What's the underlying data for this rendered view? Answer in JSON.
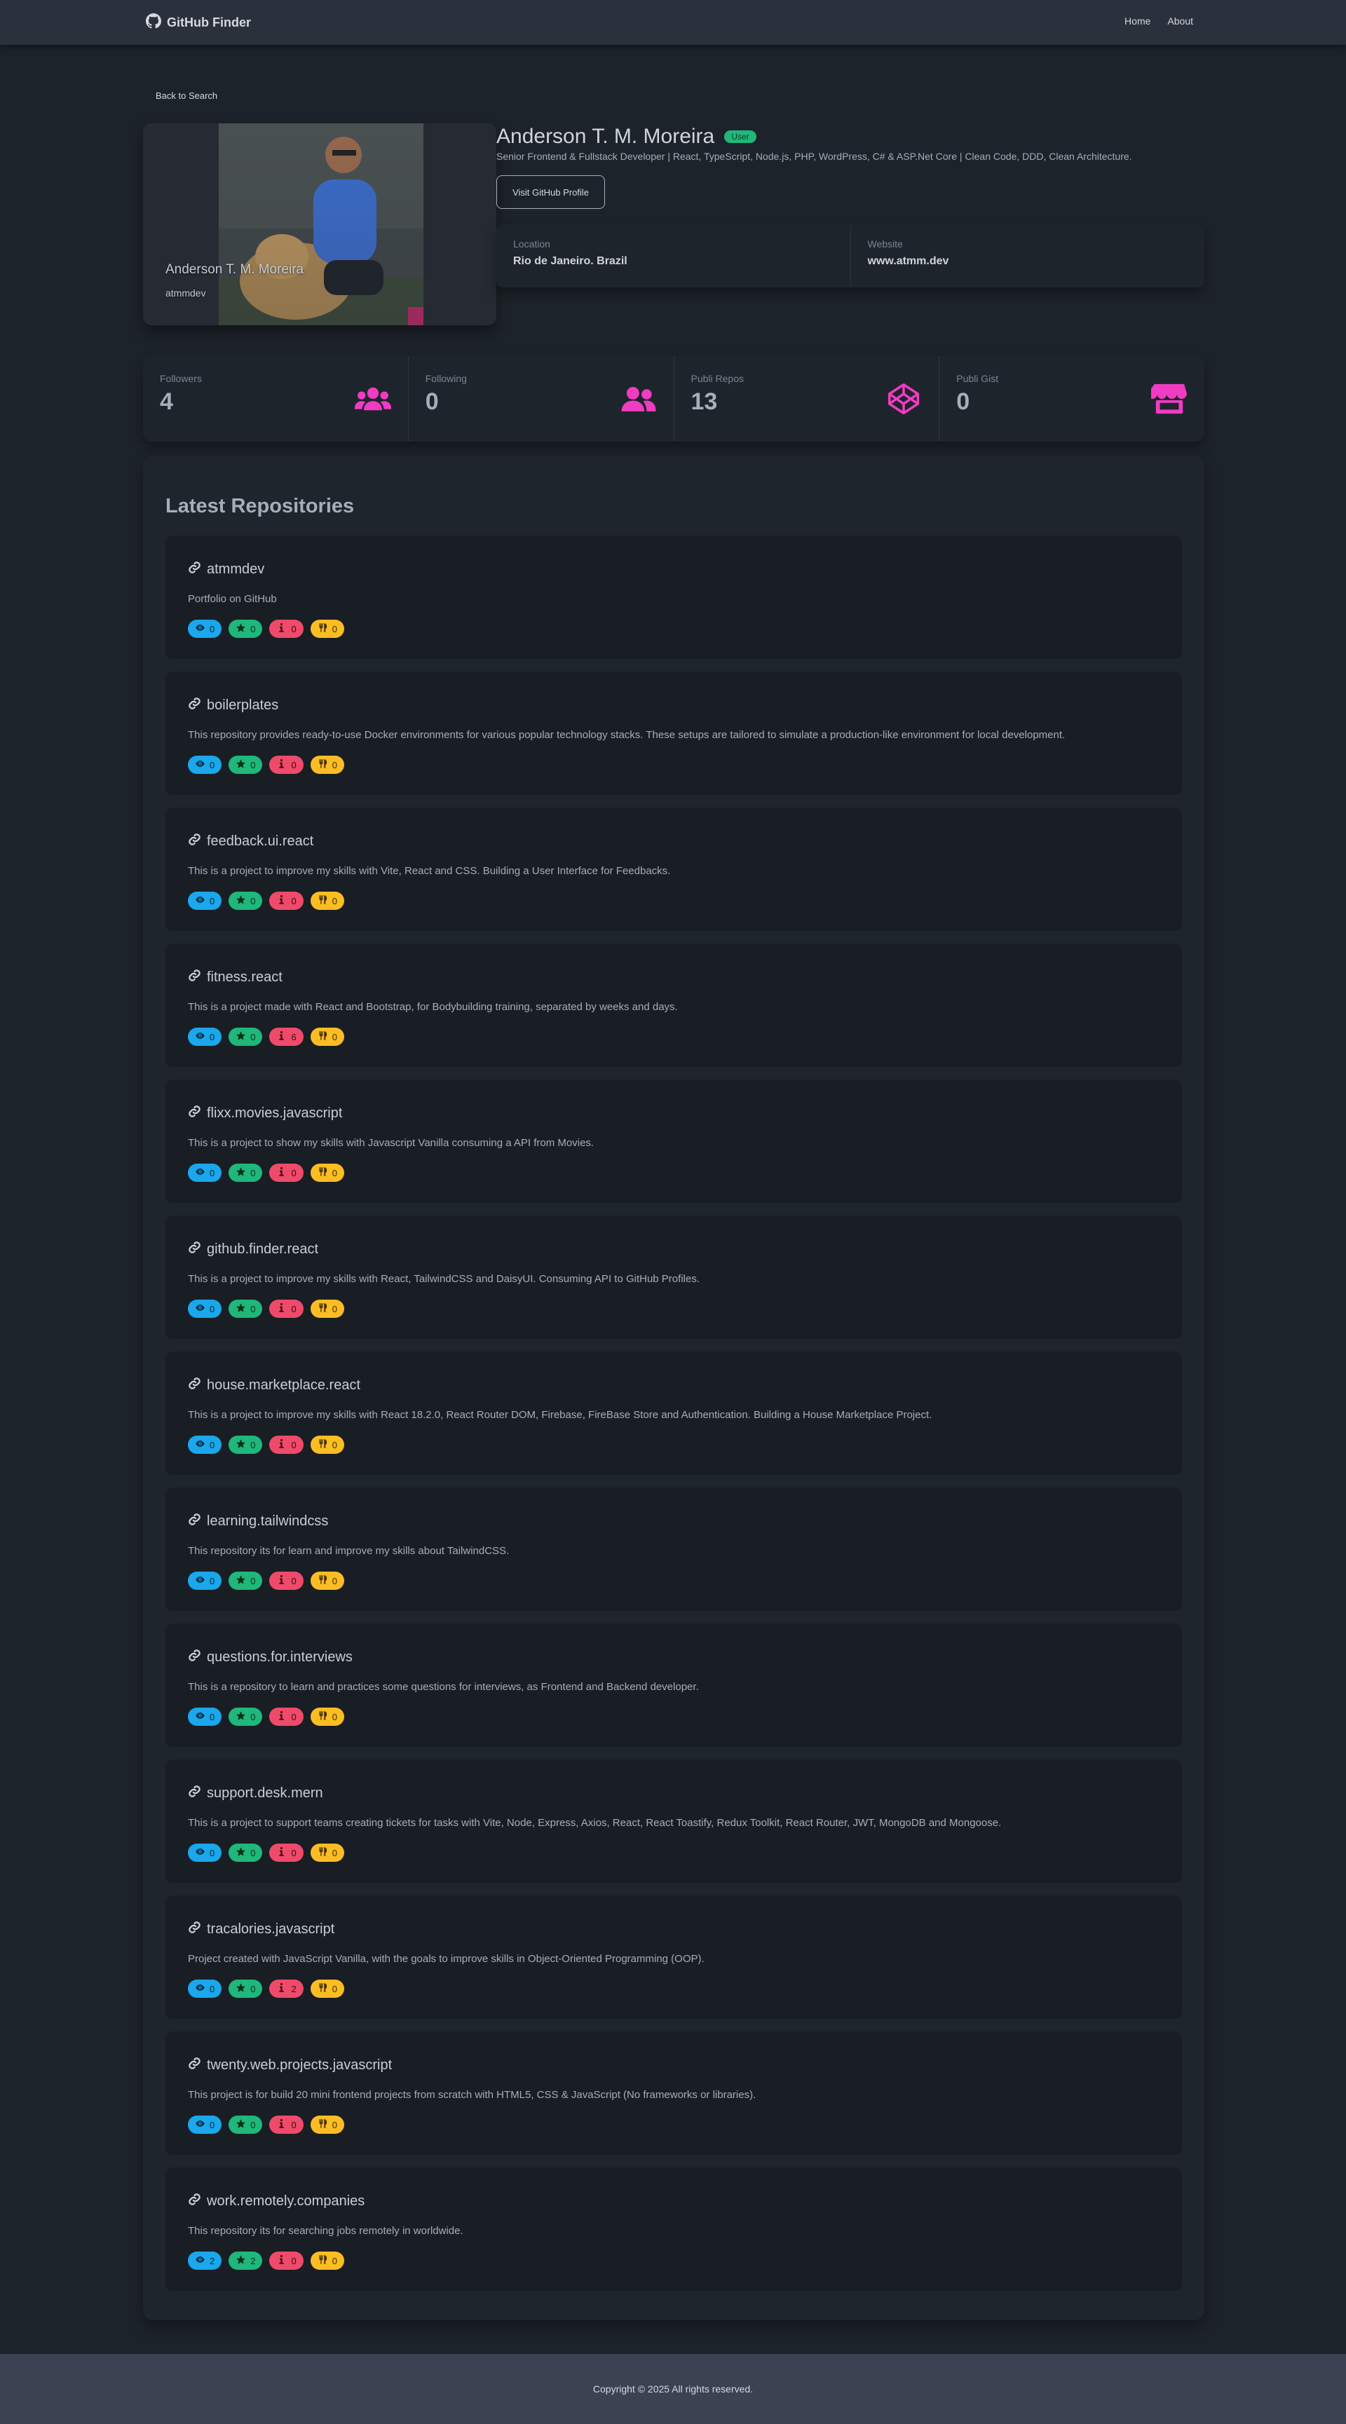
{
  "navbar": {
    "brand": "GitHub Finder",
    "links": [
      "Home",
      "About"
    ]
  },
  "back_label": "Back to Search",
  "profile": {
    "name": "Anderson T. M. Moreira",
    "login": "atmmdev",
    "type_badge": "User",
    "bio": "Senior Frontend & Fullstack Developer | React, TypeScript, Node.js, PHP, WordPress, C# & ASP.Net Core | Clean Code, DDD, Clean Architecture.",
    "visit_label": "Visit GitHub Profile",
    "location_label": "Location",
    "location": "Rio de Janeiro. Brazil",
    "website_label": "Website",
    "website": "www.atmm.dev"
  },
  "stats": [
    {
      "title": "Followers",
      "value": "4",
      "icon": "users-icon"
    },
    {
      "title": "Following",
      "value": "0",
      "icon": "user-friends-icon"
    },
    {
      "title": "Publi Repos",
      "value": "13",
      "icon": "codepen-icon"
    },
    {
      "title": "Publi Gist",
      "value": "0",
      "icon": "store-icon"
    }
  ],
  "repos_title": "Latest Repositories",
  "repos": [
    {
      "name": "atmmdev",
      "description": "Portfolio on GitHub",
      "watchers": "0",
      "stars": "0",
      "issues": "0",
      "forks": "0"
    },
    {
      "name": "boilerplates",
      "description": "This repository provides ready-to-use Docker environments for various popular technology stacks. These setups are tailored to simulate a production-like environment for local development.",
      "watchers": "0",
      "stars": "0",
      "issues": "0",
      "forks": "0"
    },
    {
      "name": "feedback.ui.react",
      "description": "This is a project to improve my skills with Vite, React and CSS. Building a User Interface for Feedbacks.",
      "watchers": "0",
      "stars": "0",
      "issues": "0",
      "forks": "0"
    },
    {
      "name": "fitness.react",
      "description": "This is a project made with React and Bootstrap, for Bodybuilding training, separated by weeks and days.",
      "watchers": "0",
      "stars": "0",
      "issues": "6",
      "forks": "0"
    },
    {
      "name": "flixx.movies.javascript",
      "description": "This is a project to show my skills with Javascript Vanilla consuming a API from Movies.",
      "watchers": "0",
      "stars": "0",
      "issues": "0",
      "forks": "0"
    },
    {
      "name": "github.finder.react",
      "description": "This is a project to improve my skills with React, TailwindCSS and DaisyUI. Consuming API to GitHub Profiles.",
      "watchers": "0",
      "stars": "0",
      "issues": "0",
      "forks": "0"
    },
    {
      "name": "house.marketplace.react",
      "description": "This is a project to improve my skills with React 18.2.0, React Router DOM, Firebase, FireBase Store and Authentication. Building a House Marketplace Project.",
      "watchers": "0",
      "stars": "0",
      "issues": "0",
      "forks": "0"
    },
    {
      "name": "learning.tailwindcss",
      "description": "This repository its for learn and improve my skills about TailwindCSS.",
      "watchers": "0",
      "stars": "0",
      "issues": "0",
      "forks": "0"
    },
    {
      "name": "questions.for.interviews",
      "description": "This is a repository to learn and practices some questions for interviews, as Frontend and Backend developer.",
      "watchers": "0",
      "stars": "0",
      "issues": "0",
      "forks": "0"
    },
    {
      "name": "support.desk.mern",
      "description": "This is a project to support teams creating tickets for tasks with Vite, Node, Express, Axios, React, React Toastify, Redux Toolkit, React Router, JWT, MongoDB and Mongoose.",
      "watchers": "0",
      "stars": "0",
      "issues": "0",
      "forks": "0"
    },
    {
      "name": "tracalories.javascript",
      "description": "Project created with JavaScript Vanilla, with the goals to improve skills in Object-Oriented Programming (OOP).",
      "watchers": "0",
      "stars": "0",
      "issues": "2",
      "forks": "0"
    },
    {
      "name": "twenty.web.projects.javascript",
      "description": "This project is for build 20 mini frontend projects from scratch with HTML5, CSS & JavaScript (No frameworks or libraries).",
      "watchers": "0",
      "stars": "0",
      "issues": "0",
      "forks": "0"
    },
    {
      "name": "work.remotely.companies",
      "description": "This repository its for searching jobs remotely in worldwide.",
      "watchers": "2",
      "stars": "2",
      "issues": "0",
      "forks": "0"
    }
  ],
  "footer": "Copyright © 2025 All rights reserved.",
  "colors": {
    "watch": "#1aa7ec",
    "star": "#1fb87a",
    "issue": "#f04a6a",
    "fork": "#fbbd23",
    "accent": "#f03cc2"
  }
}
